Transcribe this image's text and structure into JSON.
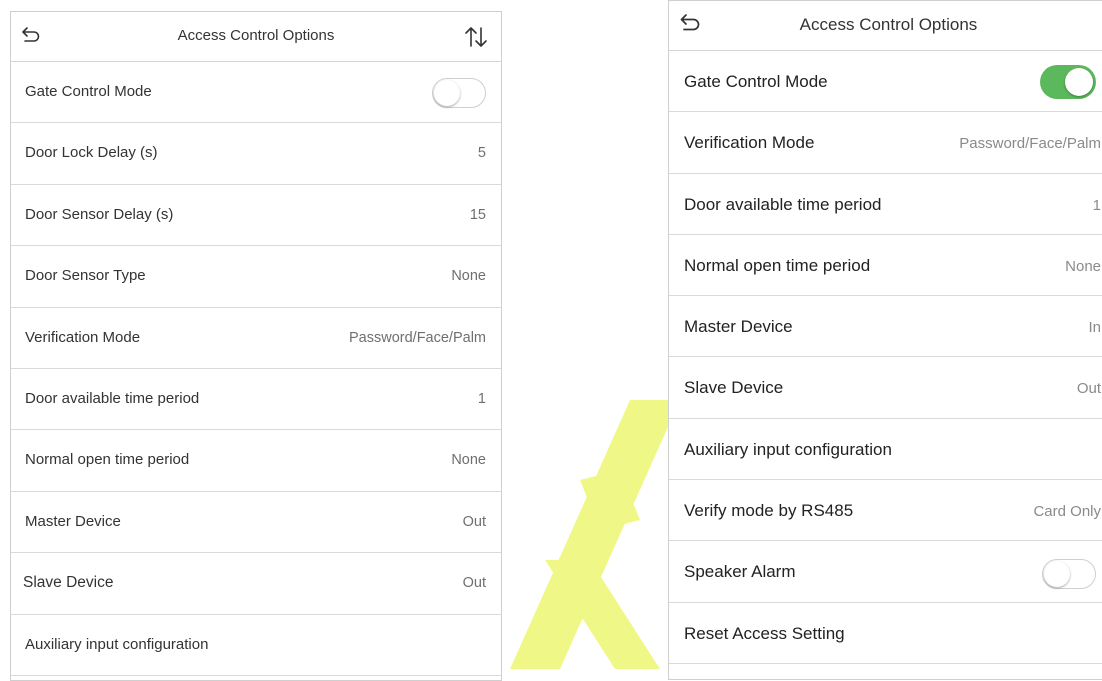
{
  "left_panel": {
    "title": "Access Control Options",
    "rows": [
      {
        "label": "Gate Control Mode",
        "toggle": "off"
      },
      {
        "label": "Door Lock Delay (s)",
        "value": "5"
      },
      {
        "label": "Door Sensor Delay (s)",
        "value": "15"
      },
      {
        "label": "Door Sensor Type",
        "value": "None"
      },
      {
        "label": "Verification Mode",
        "value": "Password/Face/Palm"
      },
      {
        "label": "Door available time period",
        "value": "1"
      },
      {
        "label": "Normal open time period",
        "value": "None"
      },
      {
        "label": "Master Device",
        "value": "Out"
      },
      {
        "label": "Slave Device",
        "value": "Out"
      },
      {
        "label": "Auxiliary input configuration",
        "value": ""
      }
    ]
  },
  "right_panel": {
    "title": "Access Control Options",
    "rows": [
      {
        "label": "Gate Control Mode",
        "toggle": "on"
      },
      {
        "label": "Verification Mode",
        "value": "Password/Face/Palm"
      },
      {
        "label": "Door available time period",
        "value": "1"
      },
      {
        "label": "Normal open time period",
        "value": "None"
      },
      {
        "label": "Master Device",
        "value": "In"
      },
      {
        "label": "Slave Device",
        "value": "Out"
      },
      {
        "label": "Auxiliary input configuration",
        "value": ""
      },
      {
        "label": "Verify mode by RS485",
        "value": "Card Only"
      },
      {
        "label": "Speaker Alarm",
        "toggle": "off"
      },
      {
        "label": "Reset Access Setting",
        "value": ""
      }
    ]
  },
  "colors": {
    "toggle_on": "#5cb85c",
    "watermark": "#e9f56e"
  }
}
